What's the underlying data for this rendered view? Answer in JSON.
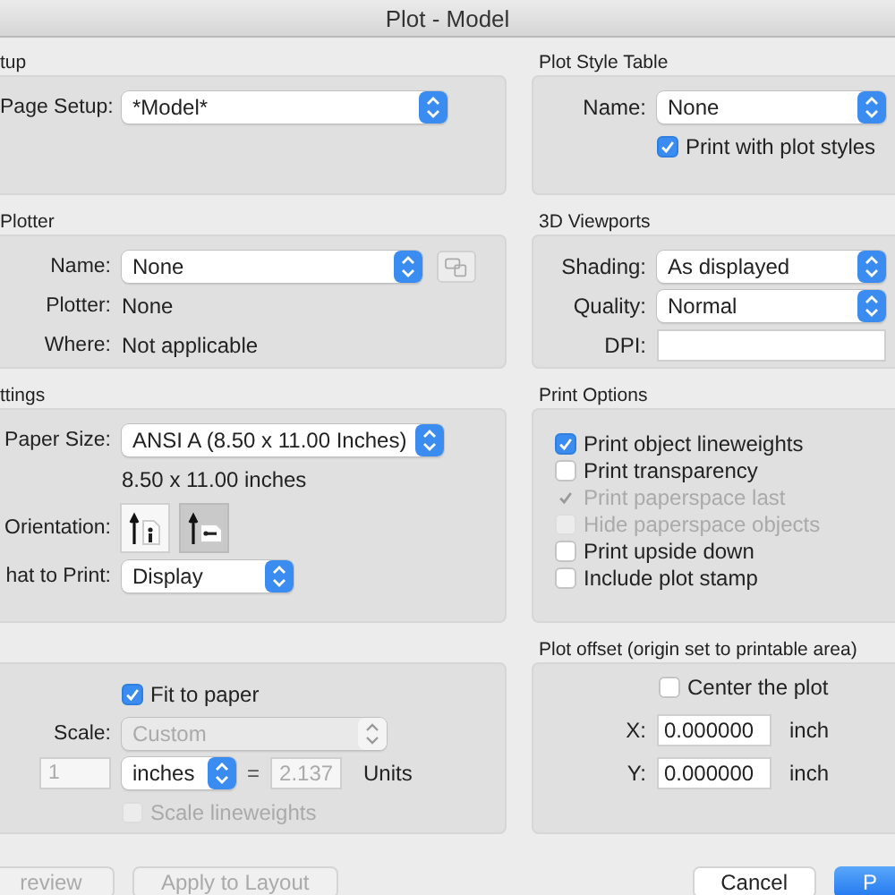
{
  "window": {
    "title": "Plot - Model"
  },
  "page_setup": {
    "heading": "tup",
    "label": "Page Setup:",
    "value": "*Model*"
  },
  "plotter": {
    "heading": "Plotter",
    "rows": [
      {
        "label": "Name:",
        "kind": "select",
        "value": "None"
      },
      {
        "label": "Plotter:",
        "kind": "text",
        "value": "None"
      },
      {
        "label": "Where:",
        "kind": "text",
        "value": "Not applicable"
      }
    ]
  },
  "settings": {
    "heading": "ttings",
    "paper_size_label": "Paper Size:",
    "paper_size": "ANSI A (8.50 x 11.00 Inches)",
    "paper_dims": "8.50 x 11.00 inches",
    "orientation_label": "Orientation:",
    "orientations": [
      {
        "kind": "portrait",
        "selected": false
      },
      {
        "kind": "landscape",
        "selected": true
      }
    ],
    "what_label": "hat to Print:",
    "what_value": "Display"
  },
  "scale": {
    "fit": {
      "label": "Fit to paper",
      "checked": true,
      "disabled": false
    },
    "scale_label": "Scale:",
    "scale_value": "Custom",
    "scale_disabled": true,
    "left_value": "1",
    "left_disabled": true,
    "unit": "inches",
    "equals": "=",
    "right_value": "2.137",
    "right_disabled": true,
    "units_label": "Units",
    "lineweights": {
      "label": "Scale lineweights",
      "checked": false,
      "disabled": true
    }
  },
  "plot_style_table": {
    "heading": "Plot Style Table",
    "name_label": "Name:",
    "name_value": "None",
    "print_with": {
      "label": "Print with plot styles",
      "checked": true,
      "disabled": false
    }
  },
  "viewports": {
    "heading": "3D Viewports",
    "fields": [
      {
        "label": "Shading:",
        "kind": "select",
        "value": "As displayed"
      },
      {
        "label": "Quality:",
        "kind": "select",
        "value": "Normal"
      },
      {
        "label": "DPI:",
        "kind": "input"
      }
    ]
  },
  "print_options": {
    "heading": "Print Options",
    "options": [
      {
        "label": "Print object lineweights",
        "checked": true,
        "disabled": false
      },
      {
        "label": "Print transparency",
        "checked": false,
        "disabled": false
      },
      {
        "label": "Print paperspace last",
        "checked": true,
        "disabled": true
      },
      {
        "label": "Hide paperspace objects",
        "checked": false,
        "disabled": true
      },
      {
        "label": "Print upside down",
        "checked": false,
        "disabled": false
      },
      {
        "label": "Include plot stamp",
        "checked": false,
        "disabled": false
      }
    ]
  },
  "plot_offset": {
    "heading": "Plot offset (origin set to printable area)",
    "center": {
      "label": "Center the plot",
      "checked": false,
      "disabled": false
    },
    "fields": [
      {
        "label": "X:",
        "value": "0.000000",
        "unit": "inch"
      },
      {
        "label": "Y:",
        "value": "0.000000",
        "unit": "inch"
      }
    ]
  },
  "buttons_left": [
    {
      "label": "review",
      "kind": "plain",
      "disabled": true
    },
    {
      "label": "Apply to Layout",
      "kind": "plain",
      "disabled": true
    }
  ],
  "buttons_right": [
    {
      "label": "Cancel",
      "kind": "plain",
      "disabled": false
    },
    {
      "label": "P",
      "kind": "default",
      "disabled": false
    }
  ]
}
